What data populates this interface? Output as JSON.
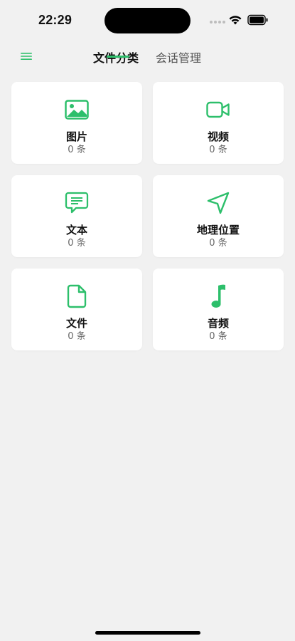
{
  "status": {
    "time": "22:29"
  },
  "nav": {
    "tabs": [
      {
        "label": "文件分类",
        "active": true
      },
      {
        "label": "会话管理",
        "active": false
      }
    ]
  },
  "categories": [
    {
      "title": "图片",
      "count": "0 条",
      "icon": "image-icon"
    },
    {
      "title": "视频",
      "count": "0 条",
      "icon": "video-icon"
    },
    {
      "title": "文本",
      "count": "0 条",
      "icon": "message-icon"
    },
    {
      "title": "地理位置",
      "count": "0 条",
      "icon": "location-icon"
    },
    {
      "title": "文件",
      "count": "0 条",
      "icon": "file-icon"
    },
    {
      "title": "音频",
      "count": "0 条",
      "icon": "music-icon"
    }
  ],
  "colors": {
    "accent": "#2dbf6b",
    "background": "#f1f1f1",
    "card": "#ffffff"
  }
}
